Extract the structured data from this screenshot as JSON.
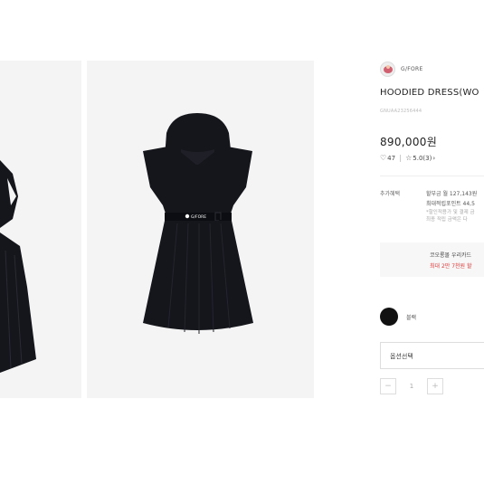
{
  "brand": {
    "name": "G/FORE"
  },
  "product": {
    "title": "HOODIED DRESS(WO",
    "code": "GNUAA23256444",
    "price": "890,000원",
    "likes": "47",
    "rating": "5.0",
    "reviews": "(3)"
  },
  "benefits": {
    "label": "추가혜택",
    "installment": "할부금 월 127,143원",
    "points": "최대적립포인트 44,5",
    "note1": "*할인적용가 및 결제 금",
    "note2": "최종 적립 금액은 다"
  },
  "coupon": {
    "line1": "코오롱몰 우리카드",
    "line2": "최대 2만 7천원 할"
  },
  "color_option": {
    "label": "블랙",
    "swatch": "#111111"
  },
  "options": {
    "select_label": "옵션선택"
  },
  "quantity": {
    "minus": "−",
    "value": "1",
    "plus": "+"
  },
  "gallery": {
    "logo_text": "G/FORE",
    "dress_color": "#15161c"
  }
}
